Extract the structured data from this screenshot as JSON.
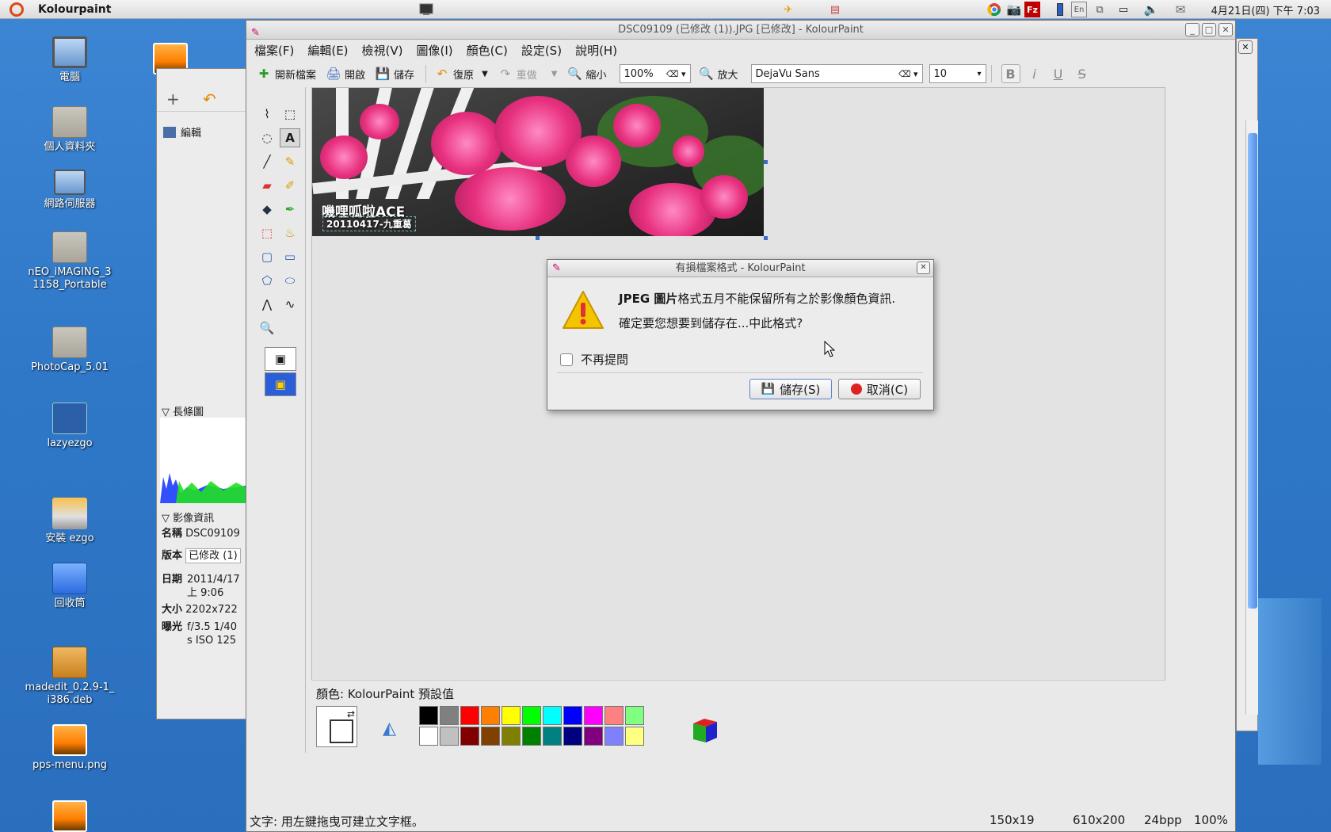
{
  "top_panel": {
    "app_name": "Kolourpaint",
    "clock": "4月21日(四) 下午 7:03",
    "tray_icons": [
      "chrome-icon",
      "camera-icon",
      "filezilla-icon",
      "battery-icon",
      "keyboard-en-icon",
      "network-icon",
      "display-icon",
      "volume-icon",
      "mail-icon"
    ],
    "tray_en": "En"
  },
  "desktop": {
    "icons": [
      {
        "label": "電腦",
        "type": "monitor"
      },
      {
        "label": "個人資料夾",
        "type": "folder"
      },
      {
        "label": "網路伺服器",
        "type": "folder"
      },
      {
        "label": "nEO_iMAGING_31158_Portable",
        "type": "folder"
      },
      {
        "label": "PhotoCap_5.01",
        "type": "folder"
      },
      {
        "label": "lazyezgo",
        "type": "folder"
      },
      {
        "label": "安裝 ezgo",
        "type": "folder"
      },
      {
        "label": "回收筒",
        "type": "trash"
      },
      {
        "label": "madedit_0.2.9-1_i386.deb",
        "type": "package"
      },
      {
        "label": "pps-menu.png",
        "type": "photo"
      }
    ]
  },
  "gwenview": {
    "edit_label": "編輯",
    "histogram_label": "長條圖",
    "image_info_label": "影像資訊",
    "info": [
      {
        "key": "名稱",
        "value": "DSC09109"
      },
      {
        "key": "版本",
        "value": "已修改 (1)"
      },
      {
        "key": "日期",
        "value": "2011/4/17 上 9:06"
      },
      {
        "key": "大小",
        "value": "2202x722"
      },
      {
        "key": "曝光",
        "value": "f/3.5 1/40 s ISO 125"
      }
    ]
  },
  "window": {
    "title": "DSC09109 (已修改 (1)).JPG [已修改] - KolourPaint",
    "menu": [
      "檔案(F)",
      "編輯(E)",
      "檢視(V)",
      "圖像(I)",
      "顏色(C)",
      "設定(S)",
      "說明(H)"
    ],
    "toolbar": {
      "new": "開新檔案",
      "open": "開啟",
      "save": "儲存",
      "undo": "復原",
      "redo": "重做",
      "zoom_out": "縮小",
      "zoom_value": "100%",
      "zoom_in": "放大",
      "font": "DejaVu Sans",
      "font_size": "10"
    },
    "photo": {
      "title": "嘰哩呱啦ACE",
      "subtitle": "20110417-九重葛"
    },
    "palette_label": "顏色: KolourPaint 預設值",
    "palette_row1": [
      "#000000",
      "#808080",
      "#ff0000",
      "#ff8000",
      "#ffff00",
      "#00ff00",
      "#00ffff",
      "#0000ff",
      "#ff00ff",
      "#ff8080",
      "#80ff80"
    ],
    "palette_row2": [
      "#ffffff",
      "#c0c0c0",
      "#800000",
      "#804000",
      "#808000",
      "#008000",
      "#008080",
      "#000080",
      "#800080",
      "#8080ff",
      "#ffff80"
    ],
    "status": {
      "hint": "文字:  用左鍵拖曳可建立文字框。",
      "selection_size": "150x19",
      "image_size": "610x200",
      "depth": "24bpp",
      "zoom": "100%"
    }
  },
  "dialog": {
    "title": "有損檔案格式 - KolourPaint",
    "message_bold": "JPEG 圖片",
    "message_rest": "格式五月不能保留所有之於影像顏色資訊.",
    "question": "確定要您想要到儲存在...中此格式?",
    "checkbox_label": "不再提問",
    "save_button": "儲存(S)",
    "cancel_button": "取消(C)"
  }
}
